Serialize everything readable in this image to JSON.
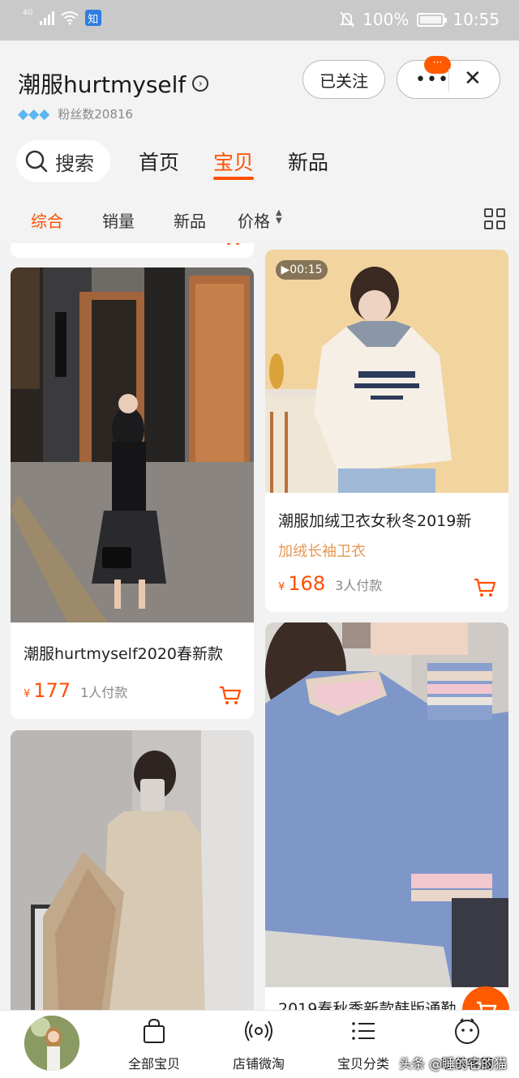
{
  "status_bar": {
    "network": "4G",
    "notification_badge": "知",
    "battery": "100%",
    "battery_level": 1.0,
    "time": "10:55"
  },
  "shop": {
    "name": "潮服hurtmyself",
    "fans": "粉丝数20816",
    "follow_label": "已关注",
    "badge_count": "···"
  },
  "tabs": {
    "search": "搜索",
    "items": [
      "首页",
      "宝贝",
      "新品"
    ],
    "active": "宝贝"
  },
  "filters": {
    "items": [
      "综合",
      "销量",
      "新品",
      "价格"
    ],
    "active": "综合"
  },
  "products": [
    {
      "title": "潮服hurtmyself2020春新款",
      "currency": "¥",
      "price": "177",
      "sold": "1人付款"
    },
    {
      "video_time": "▶00:15",
      "title": "潮服加绒卫衣女秋冬2019新",
      "subtitle": "加绒长袖卫衣",
      "currency": "¥",
      "price": "168",
      "sold": "3人付款"
    },
    {
      "title": ""
    },
    {
      "title": "2019春秋季新款韩版通勤"
    }
  ],
  "bottom_nav": {
    "items": [
      "全部宝贝",
      "店铺微淘",
      "宝贝分类",
      "联系客服"
    ]
  },
  "watermark": "头条 @睡的它的猫",
  "colors": {
    "accent": "#ff5000",
    "subtitle": "#e49a55",
    "status_bar": "#c9c9c9"
  },
  "icons": [
    "search-icon",
    "cart-icon",
    "bag-icon",
    "broadcast-icon",
    "list-icon",
    "chat-face-icon",
    "grid-icon",
    "close-icon",
    "more-icon"
  ]
}
